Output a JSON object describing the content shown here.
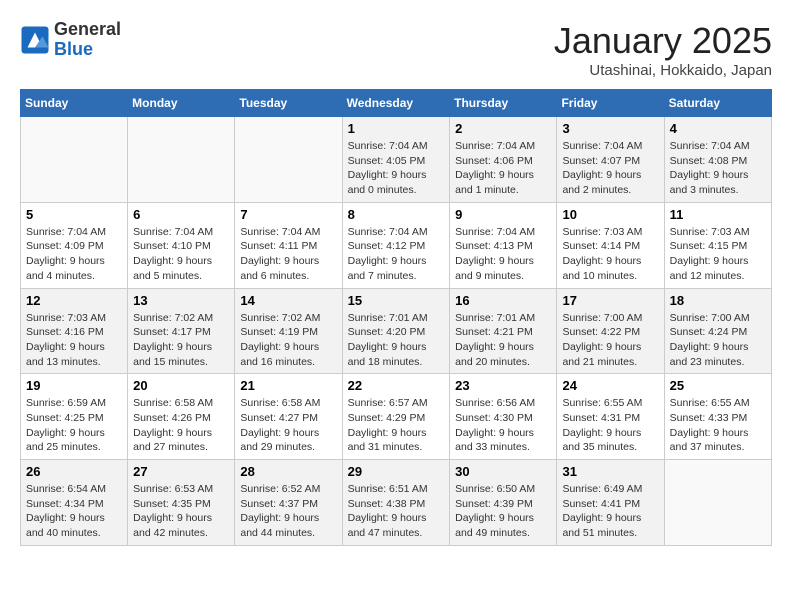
{
  "header": {
    "logo_general": "General",
    "logo_blue": "Blue",
    "month_title": "January 2025",
    "location": "Utashinai, Hokkaido, Japan"
  },
  "weekdays": [
    "Sunday",
    "Monday",
    "Tuesday",
    "Wednesday",
    "Thursday",
    "Friday",
    "Saturday"
  ],
  "weeks": [
    [
      {
        "day": "",
        "info": ""
      },
      {
        "day": "",
        "info": ""
      },
      {
        "day": "",
        "info": ""
      },
      {
        "day": "1",
        "info": "Sunrise: 7:04 AM\nSunset: 4:05 PM\nDaylight: 9 hours and 0 minutes."
      },
      {
        "day": "2",
        "info": "Sunrise: 7:04 AM\nSunset: 4:06 PM\nDaylight: 9 hours and 1 minute."
      },
      {
        "day": "3",
        "info": "Sunrise: 7:04 AM\nSunset: 4:07 PM\nDaylight: 9 hours and 2 minutes."
      },
      {
        "day": "4",
        "info": "Sunrise: 7:04 AM\nSunset: 4:08 PM\nDaylight: 9 hours and 3 minutes."
      }
    ],
    [
      {
        "day": "5",
        "info": "Sunrise: 7:04 AM\nSunset: 4:09 PM\nDaylight: 9 hours and 4 minutes."
      },
      {
        "day": "6",
        "info": "Sunrise: 7:04 AM\nSunset: 4:10 PM\nDaylight: 9 hours and 5 minutes."
      },
      {
        "day": "7",
        "info": "Sunrise: 7:04 AM\nSunset: 4:11 PM\nDaylight: 9 hours and 6 minutes."
      },
      {
        "day": "8",
        "info": "Sunrise: 7:04 AM\nSunset: 4:12 PM\nDaylight: 9 hours and 7 minutes."
      },
      {
        "day": "9",
        "info": "Sunrise: 7:04 AM\nSunset: 4:13 PM\nDaylight: 9 hours and 9 minutes."
      },
      {
        "day": "10",
        "info": "Sunrise: 7:03 AM\nSunset: 4:14 PM\nDaylight: 9 hours and 10 minutes."
      },
      {
        "day": "11",
        "info": "Sunrise: 7:03 AM\nSunset: 4:15 PM\nDaylight: 9 hours and 12 minutes."
      }
    ],
    [
      {
        "day": "12",
        "info": "Sunrise: 7:03 AM\nSunset: 4:16 PM\nDaylight: 9 hours and 13 minutes."
      },
      {
        "day": "13",
        "info": "Sunrise: 7:02 AM\nSunset: 4:17 PM\nDaylight: 9 hours and 15 minutes."
      },
      {
        "day": "14",
        "info": "Sunrise: 7:02 AM\nSunset: 4:19 PM\nDaylight: 9 hours and 16 minutes."
      },
      {
        "day": "15",
        "info": "Sunrise: 7:01 AM\nSunset: 4:20 PM\nDaylight: 9 hours and 18 minutes."
      },
      {
        "day": "16",
        "info": "Sunrise: 7:01 AM\nSunset: 4:21 PM\nDaylight: 9 hours and 20 minutes."
      },
      {
        "day": "17",
        "info": "Sunrise: 7:00 AM\nSunset: 4:22 PM\nDaylight: 9 hours and 21 minutes."
      },
      {
        "day": "18",
        "info": "Sunrise: 7:00 AM\nSunset: 4:24 PM\nDaylight: 9 hours and 23 minutes."
      }
    ],
    [
      {
        "day": "19",
        "info": "Sunrise: 6:59 AM\nSunset: 4:25 PM\nDaylight: 9 hours and 25 minutes."
      },
      {
        "day": "20",
        "info": "Sunrise: 6:58 AM\nSunset: 4:26 PM\nDaylight: 9 hours and 27 minutes."
      },
      {
        "day": "21",
        "info": "Sunrise: 6:58 AM\nSunset: 4:27 PM\nDaylight: 9 hours and 29 minutes."
      },
      {
        "day": "22",
        "info": "Sunrise: 6:57 AM\nSunset: 4:29 PM\nDaylight: 9 hours and 31 minutes."
      },
      {
        "day": "23",
        "info": "Sunrise: 6:56 AM\nSunset: 4:30 PM\nDaylight: 9 hours and 33 minutes."
      },
      {
        "day": "24",
        "info": "Sunrise: 6:55 AM\nSunset: 4:31 PM\nDaylight: 9 hours and 35 minutes."
      },
      {
        "day": "25",
        "info": "Sunrise: 6:55 AM\nSunset: 4:33 PM\nDaylight: 9 hours and 37 minutes."
      }
    ],
    [
      {
        "day": "26",
        "info": "Sunrise: 6:54 AM\nSunset: 4:34 PM\nDaylight: 9 hours and 40 minutes."
      },
      {
        "day": "27",
        "info": "Sunrise: 6:53 AM\nSunset: 4:35 PM\nDaylight: 9 hours and 42 minutes."
      },
      {
        "day": "28",
        "info": "Sunrise: 6:52 AM\nSunset: 4:37 PM\nDaylight: 9 hours and 44 minutes."
      },
      {
        "day": "29",
        "info": "Sunrise: 6:51 AM\nSunset: 4:38 PM\nDaylight: 9 hours and 47 minutes."
      },
      {
        "day": "30",
        "info": "Sunrise: 6:50 AM\nSunset: 4:39 PM\nDaylight: 9 hours and 49 minutes."
      },
      {
        "day": "31",
        "info": "Sunrise: 6:49 AM\nSunset: 4:41 PM\nDaylight: 9 hours and 51 minutes."
      },
      {
        "day": "",
        "info": ""
      }
    ]
  ]
}
